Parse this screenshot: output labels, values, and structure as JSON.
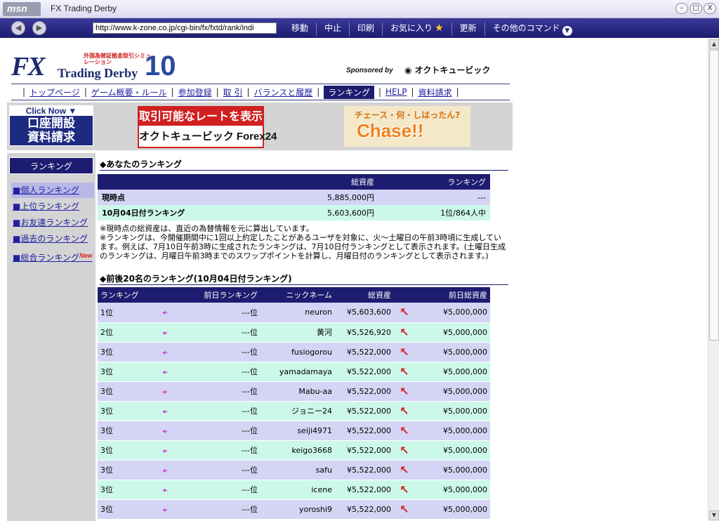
{
  "browser": {
    "logo": "msn",
    "title": "FX Trading Derby",
    "address": "http://www.k-zone.co.jp/cgi-bin/fx/fxtd/rank/indi",
    "commands": [
      "移動",
      "中止",
      "印刷",
      "お気に入り",
      "更新",
      "その他のコマンド"
    ],
    "window_buttons": [
      "–",
      "□",
      "X"
    ]
  },
  "logo": {
    "fx": "FX",
    "trading_derby": "Trading Derby",
    "subtitle": "外国為替証拠金取引シミュレーション",
    "number": "10"
  },
  "sponsor": {
    "label": "Sponsored by",
    "brand": "オクトキュービック"
  },
  "topnav": [
    "トップページ",
    "ゲーム概要・ルール",
    "参加登録",
    "取 引",
    "バランスと履歴",
    "ランキング",
    "HELP",
    "資料請求"
  ],
  "banners": {
    "click_top": "Click Now ▼",
    "click_main": "口座開設\n資料請求",
    "rate_top": "取引可能なレートを表示",
    "rate_bottom": "オクトキュービック Forex24",
    "chase_top": "チェース・何・しはったん?",
    "chase_main": "Chase!!"
  },
  "sidebar": {
    "title": "ランキング",
    "items": [
      "■個人ランキング",
      "■上位ランキング",
      "■お友達ランキング",
      "■過去のランキング",
      "■総合ランキング"
    ],
    "new_badge": "New"
  },
  "my_ranking": {
    "title": "◆あなたのランキング",
    "headers": [
      "",
      "総資産",
      "ランキング"
    ],
    "rows": [
      {
        "label": "現時点",
        "asset": "5,885,000円",
        "rank": "---"
      },
      {
        "label": "10月04日付ランキング",
        "asset": "5,603,600円",
        "rank": "1位/864人中"
      }
    ],
    "note": "※現時点の総資産は、直近の為替情報を元に算出しています。\n※ランキングは、今開催期間中に1回以上約定したことがあるユーザを対象に、火〜土曜日の午前3時頃に生成しています。例えば、7月10日午前3時に生成されたランキングは、7月10日付ランキングとして表示されます。(土曜日生成のランキングは、月曜日午前3時までのスワップポイントを計算し、月曜日付のランキングとして表示されます。)"
  },
  "top20": {
    "title": "◆前後20名のランキング(10月04日付ランキング)",
    "headers": [
      "ランキング",
      "",
      "前日ランキング",
      "ニックネーム",
      "総資産",
      "",
      "前日総資産"
    ],
    "rows": [
      {
        "rank": "1位",
        "prev_rank": "---位",
        "nick": "neuron",
        "asset": "¥5,603,600",
        "prev_asset": "¥5,000,000"
      },
      {
        "rank": "2位",
        "prev_rank": "---位",
        "nick": "黄河",
        "asset": "¥5,526,920",
        "prev_asset": "¥5,000,000"
      },
      {
        "rank": "3位",
        "prev_rank": "---位",
        "nick": "fusiogorou",
        "asset": "¥5,522,000",
        "prev_asset": "¥5,000,000"
      },
      {
        "rank": "3位",
        "prev_rank": "---位",
        "nick": "yamadamaya",
        "asset": "¥5,522,000",
        "prev_asset": "¥5,000,000"
      },
      {
        "rank": "3位",
        "prev_rank": "---位",
        "nick": "Mabu-aa",
        "asset": "¥5,522,000",
        "prev_asset": "¥5,000,000"
      },
      {
        "rank": "3位",
        "prev_rank": "---位",
        "nick": "ジョニー24",
        "asset": "¥5,522,000",
        "prev_asset": "¥5,000,000"
      },
      {
        "rank": "3位",
        "prev_rank": "---位",
        "nick": "seiji4971",
        "asset": "¥5,522,000",
        "prev_asset": "¥5,000,000"
      },
      {
        "rank": "3位",
        "prev_rank": "---位",
        "nick": "keigo3668",
        "asset": "¥5,522,000",
        "prev_asset": "¥5,000,000"
      },
      {
        "rank": "3位",
        "prev_rank": "---位",
        "nick": "safu",
        "asset": "¥5,522,000",
        "prev_asset": "¥5,000,000"
      },
      {
        "rank": "3位",
        "prev_rank": "---位",
        "nick": "icene",
        "asset": "¥5,522,000",
        "prev_asset": "¥5,000,000"
      },
      {
        "rank": "3位",
        "prev_rank": "---位",
        "nick": "yoroshi9",
        "asset": "¥5,522,000",
        "prev_asset": "¥5,000,000"
      }
    ]
  },
  "colors": {
    "navy": "#1c1c70",
    "lavender_row": "#d4d4f4",
    "mint_row": "#ccf8ea",
    "link": "#2020a0",
    "up_arrow": "#d02020"
  }
}
